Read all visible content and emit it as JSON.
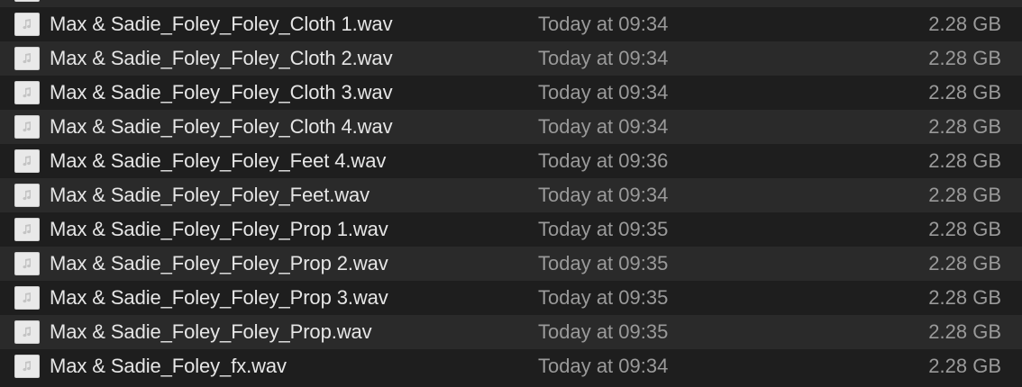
{
  "files": [
    {
      "name": "",
      "modified": "",
      "size": ""
    },
    {
      "name": "Max & Sadie_Foley_Foley_Cloth 1.wav",
      "modified": "Today at 09:34",
      "size": "2.28 GB"
    },
    {
      "name": "Max & Sadie_Foley_Foley_Cloth 2.wav",
      "modified": "Today at 09:34",
      "size": "2.28 GB"
    },
    {
      "name": "Max & Sadie_Foley_Foley_Cloth 3.wav",
      "modified": "Today at 09:34",
      "size": "2.28 GB"
    },
    {
      "name": "Max & Sadie_Foley_Foley_Cloth 4.wav",
      "modified": "Today at 09:34",
      "size": "2.28 GB"
    },
    {
      "name": "Max & Sadie_Foley_Foley_Feet 4.wav",
      "modified": "Today at 09:36",
      "size": "2.28 GB"
    },
    {
      "name": "Max & Sadie_Foley_Foley_Feet.wav",
      "modified": "Today at 09:34",
      "size": "2.28 GB"
    },
    {
      "name": "Max & Sadie_Foley_Foley_Prop 1.wav",
      "modified": "Today at 09:35",
      "size": "2.28 GB"
    },
    {
      "name": "Max & Sadie_Foley_Foley_Prop 2.wav",
      "modified": "Today at 09:35",
      "size": "2.28 GB"
    },
    {
      "name": "Max & Sadie_Foley_Foley_Prop 3.wav",
      "modified": "Today at 09:35",
      "size": "2.28 GB"
    },
    {
      "name": "Max & Sadie_Foley_Foley_Prop.wav",
      "modified": "Today at 09:35",
      "size": "2.28 GB"
    },
    {
      "name": "Max & Sadie_Foley_fx.wav",
      "modified": "Today at 09:34",
      "size": "2.28 GB"
    }
  ],
  "icon": "audio-file-icon",
  "colors": {
    "background": "#1e1e1e",
    "row_alt": "#2a2a2a",
    "name_text": "#e6e6e6",
    "meta_text": "#9a9a9a"
  }
}
